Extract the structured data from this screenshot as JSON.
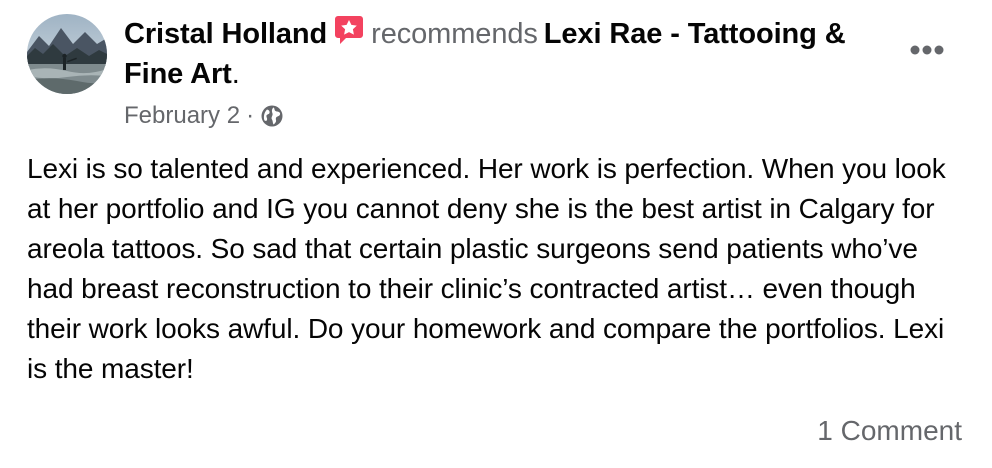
{
  "post": {
    "author": "Cristal Holland",
    "action": "recommends",
    "page": "Lexi Rae - Tattooing & Fine Art",
    "page_suffix": ".",
    "date": "February 2",
    "separator": "·",
    "privacy_icon": "globe-icon",
    "recommend_badge_icon": "star-speech-bubble-icon",
    "more_icon": "more-options-icon",
    "body": "Lexi is so talented and experienced. Her work is perfection. When you look at her portfolio and IG you cannot deny she is the best artist in Calgary for areola tattoos. So sad that certain plastic surgeons send patients who’ve had breast reconstruction to their clinic’s contracted artist… even though their work looks awful. Do your homework and compare the portfolios. Lexi is the master!",
    "comments_label": "1 Comment"
  },
  "colors": {
    "text_primary": "#050505",
    "text_secondary": "#65676b",
    "badge": "#f3425f"
  }
}
